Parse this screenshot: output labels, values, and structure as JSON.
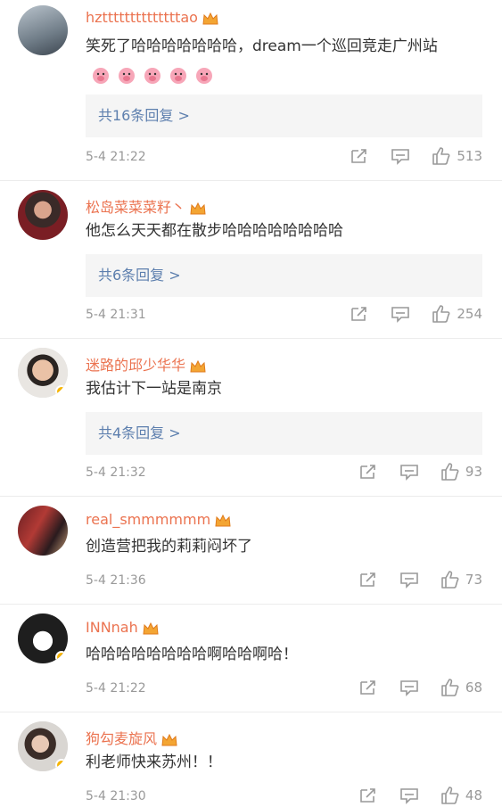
{
  "colors": {
    "username": "#eb7350",
    "reply_link": "#5d7fae",
    "meta": "#999999",
    "badge": "#f7b500"
  },
  "icons": {
    "share": "share-icon",
    "comment": "comment-icon",
    "like": "thumbs-up-icon",
    "vip": "crown-badge-icon",
    "verified": "verified-badge-icon"
  },
  "comments": [
    {
      "username": "hzttttttttttttttao",
      "text": "笑死了哈哈哈哈哈哈哈，dream一个巡回竞走广州站",
      "emoji_count": 5,
      "replies": "共16条回复 >",
      "time": "5-4 21:22",
      "likes": "513"
    },
    {
      "username": "松岛菜菜菜籽丶",
      "text": "他怎么天天都在散步哈哈哈哈哈哈哈哈",
      "replies": "共6条回复 >",
      "time": "5-4 21:31",
      "likes": "254"
    },
    {
      "username": "迷路的邱少华华",
      "text": "我估计下一站是南京",
      "replies": "共4条回复 >",
      "time": "5-4 21:32",
      "likes": "93"
    },
    {
      "username": "real_smmmmmm",
      "text": "创造营把我的莉莉闷坏了",
      "time": "5-4 21:36",
      "likes": "73"
    },
    {
      "username": "INNnah",
      "text": "哈哈哈哈哈哈哈哈啊哈哈啊哈！",
      "time": "5-4 21:22",
      "likes": "68"
    },
    {
      "username": "狗勾麦旋风",
      "text": "利老师快来苏州！！",
      "time": "5-4 21:30",
      "likes": "48"
    }
  ]
}
